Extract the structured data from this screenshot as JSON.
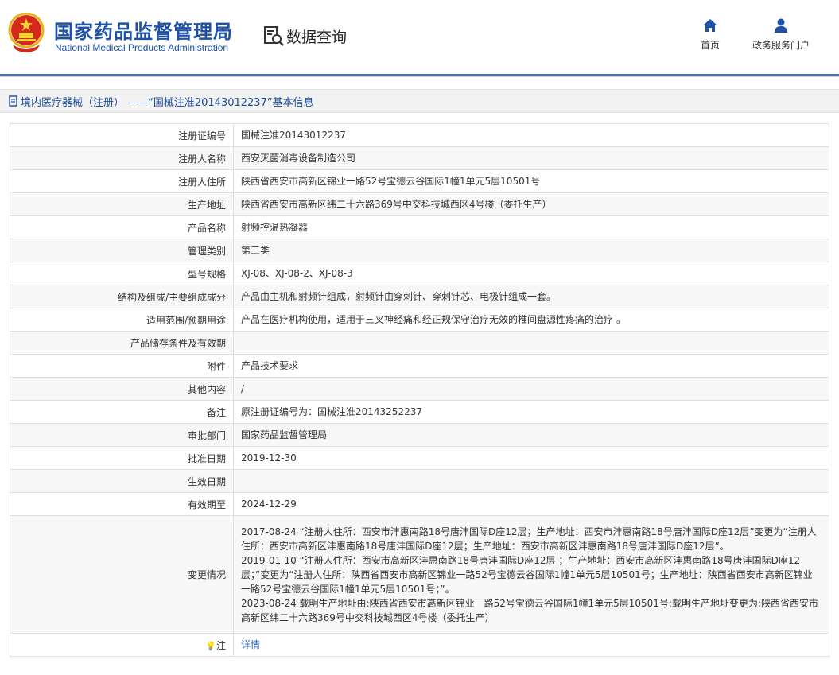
{
  "header": {
    "org_cn": "国家药品监督管理局",
    "org_en": "National Medical Products Administration",
    "search_title": "数据查询",
    "nav": [
      {
        "label": "首页",
        "icon": "home-icon"
      },
      {
        "label": "政务服务门户",
        "icon": "user-icon"
      }
    ]
  },
  "title_bar": {
    "text": "境内医疗器械（注册） ——“国械注准20143012237”基本信息",
    "icon": "document-icon"
  },
  "colors": {
    "brand": "#1d52a8",
    "accent_line": "#3e73c4",
    "row_alt": "#f7f7f7"
  },
  "record": {
    "rows": [
      {
        "label": "注册证编号",
        "value": "国械注准20143012237"
      },
      {
        "label": "注册人名称",
        "value": "西安灭菌消毒设备制造公司"
      },
      {
        "label": "注册人住所",
        "value": "陕西省西安市高新区锦业一路52号宝德云谷国际1幢1单元5层10501号"
      },
      {
        "label": "生产地址",
        "value": "陕西省西安市高新区纬二十六路369号中交科技城西区4号楼（委托生产）"
      },
      {
        "label": "产品名称",
        "value": "射频控温热凝器"
      },
      {
        "label": "管理类别",
        "value": "第三类"
      },
      {
        "label": "型号规格",
        "value": "XJ-08、XJ-08-2、XJ-08-3"
      },
      {
        "label": "结构及组成/主要组成成分",
        "value": "产品由主机和射频针组成，射频针由穿刺针、穿刺针芯、电极针组成一套。"
      },
      {
        "label": "适用范围/预期用途",
        "value": "产品在医疗机构使用，适用于三叉神经痛和经正规保守治疗无效的椎间盘源性疼痛的治疗 。"
      },
      {
        "label": "产品储存条件及有效期",
        "value": ""
      },
      {
        "label": "附件",
        "value": "产品技术要求"
      },
      {
        "label": "其他内容",
        "value": "/"
      },
      {
        "label": "备注",
        "value": "原注册证编号为：国械注准20143252237"
      },
      {
        "label": "审批部门",
        "value": "国家药品监督管理局"
      },
      {
        "label": "批准日期",
        "value": "2019-12-30"
      },
      {
        "label": "生效日期",
        "value": ""
      },
      {
        "label": "有效期至",
        "value": "2024-12-29"
      }
    ],
    "changes_label": "变更情况",
    "changes": [
      "2017-08-24 “注册人住所：西安市沣惠南路18号唐沣国际D座12层；生产地址：西安市沣惠南路18号唐沣国际D座12层”变更为“注册人住所：西安市高新区沣惠南路18号唐沣国际D座12层；生产地址：西安市高新区沣惠南路18号唐沣国际D座12层”。",
      "2019-01-10 “注册人住所：西安市高新区沣惠南路18号唐沣国际D座12层 ；生产地址：西安市高新区沣惠南路18号唐沣国际D座12层；”变更为“注册人住所：陕西省西安市高新区锦业一路52号宝德云谷国际1幢1单元5层10501号；生产地址：陕西省西安市高新区锦业一路52号宝德云谷国际1幢1单元5层10501号；”。",
      "2023-08-24 载明生产地址由:陕西省西安市高新区锦业一路52号宝德云谷国际1幢1单元5层10501号;载明生产地址变更为:陕西省西安市高新区纬二十六路369号中交科技城西区4号楼（委托生产）"
    ],
    "note_label": "注",
    "note_link": "详情"
  }
}
